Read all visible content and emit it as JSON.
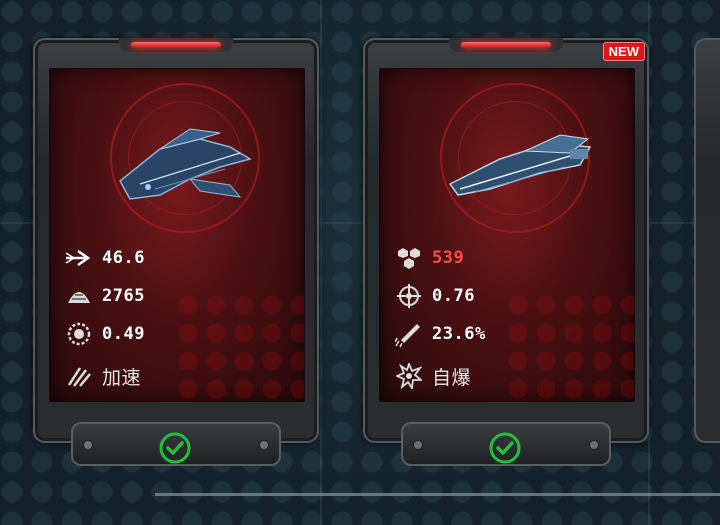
{
  "cards": [
    {
      "new_badge": "",
      "ship_color": "#3a5f8c",
      "stats": [
        {
          "icon": "speed-arrow-icon",
          "value": "46.6"
        },
        {
          "icon": "armor-plate-icon",
          "value": "2765"
        },
        {
          "icon": "shield-ring-icon",
          "value": "0.49"
        },
        {
          "icon": "boost-streak-icon",
          "value": "加速"
        }
      ],
      "equipped": true
    },
    {
      "new_badge": "NEW",
      "ship_color": "#5a86aa",
      "stats": [
        {
          "icon": "hexagon-cluster-icon",
          "value": "539",
          "highlight": "#ff4a4a"
        },
        {
          "icon": "crosshair-icon",
          "value": "0.76"
        },
        {
          "icon": "missile-launch-icon",
          "value": "23.6%"
        },
        {
          "icon": "explosion-icon",
          "value": "自爆"
        }
      ],
      "equipped": true
    }
  ],
  "colors": {
    "accent_red": "#e0141c",
    "check_green": "#22c03a"
  }
}
